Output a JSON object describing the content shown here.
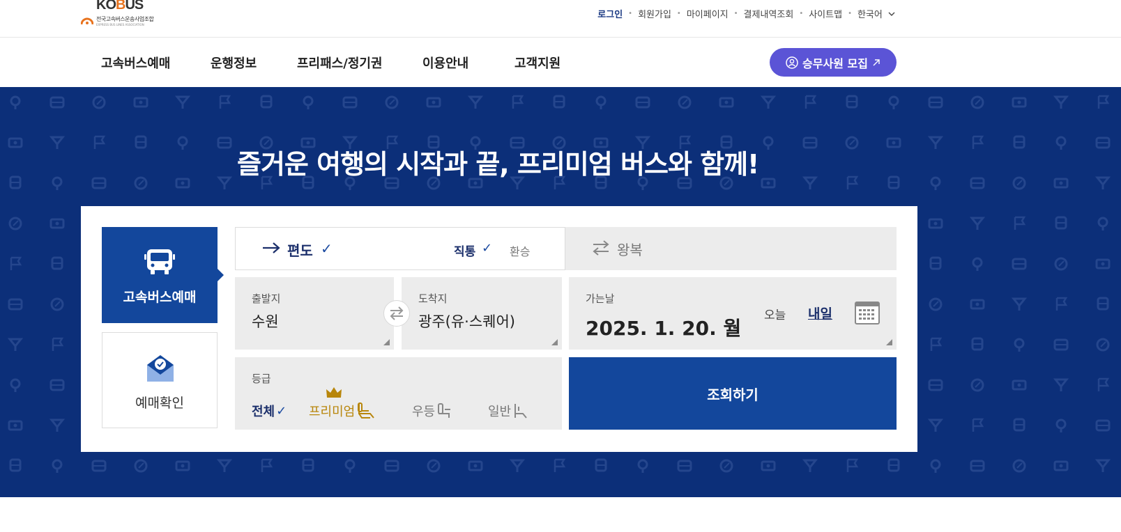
{
  "header": {
    "logo": {
      "word": "KOBUS",
      "subtitle": "전국고속버스운송사업조합",
      "english": "EXPRESS BUS LINES ASSOCIATION"
    },
    "util_links": [
      "로그인",
      "회원가입",
      "마이페이지",
      "결제내역조회",
      "사이트맵"
    ],
    "language": "한국어"
  },
  "nav": {
    "items": [
      "고속버스예매",
      "운행정보",
      "프리패스/정기권",
      "이용안내",
      "고객지원"
    ],
    "recruit_label": "승무사원 모집"
  },
  "hero": {
    "headline": "즐거운 여행의 시작과 끝, 프리미엄 버스와 함께!"
  },
  "booking": {
    "side_tabs": {
      "bus_booking": "고속버스예매",
      "booking_check": "예매확인"
    },
    "trip": {
      "one_way": "편도",
      "direct": "직통",
      "transfer": "환승",
      "round_trip": "왕복"
    },
    "departure": {
      "label": "출발지",
      "value": "수원"
    },
    "arrival": {
      "label": "도착지",
      "value": "광주(유·스퀘어)"
    },
    "date": {
      "label": "가는날",
      "value": "2025. 1. 20. 월",
      "today": "오늘",
      "tomorrow": "내일"
    },
    "grade": {
      "label": "등급",
      "options": {
        "all": "전체",
        "premium": "프리미엄",
        "excellent": "우등",
        "general": "일반"
      }
    },
    "search_label": "조회하기"
  },
  "colors": {
    "hero_bg": "#0c2f79",
    "primary": "#13479c",
    "recruit": "#5b54d6",
    "premium": "#b8860b"
  }
}
